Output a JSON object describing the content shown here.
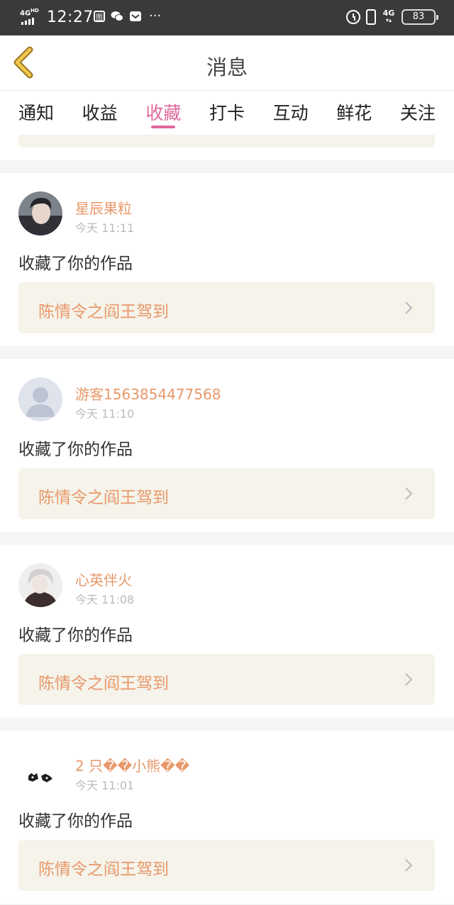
{
  "status_bar": {
    "network": "4G",
    "network_sup": "HD",
    "time": "12:27",
    "signal_right": "4G",
    "battery": "83"
  },
  "header": {
    "title": "消息"
  },
  "tabs": [
    {
      "label": "通知",
      "active": false
    },
    {
      "label": "收益",
      "active": false
    },
    {
      "label": "收藏",
      "active": true
    },
    {
      "label": "打卡",
      "active": false
    },
    {
      "label": "互动",
      "active": false
    },
    {
      "label": "鲜花",
      "active": false
    },
    {
      "label": "关注",
      "active": false
    }
  ],
  "messages": [
    {
      "user": "星辰果粒",
      "time": "今天 11:11",
      "action": "收藏了你的作品",
      "work": "陈情令之阎王驾到"
    },
    {
      "user": "游客1563854477568",
      "time": "今天 11:10",
      "action": "收藏了你的作品",
      "work": "陈情令之阎王驾到"
    },
    {
      "user": "心英伴火",
      "time": "今天 11:08",
      "action": "收藏了你的作品",
      "work": "陈情令之阎王驾到"
    },
    {
      "user": "2 只��小熊��",
      "time": "今天 11:01",
      "action": "收藏了你的作品",
      "work": "陈情令之阎王驾到"
    }
  ],
  "colors": {
    "accent_pink": "#e0689b",
    "username_orange": "#e8986a",
    "work_box_bg": "#f5f3ea",
    "status_bar_bg": "#3a3a3a"
  }
}
